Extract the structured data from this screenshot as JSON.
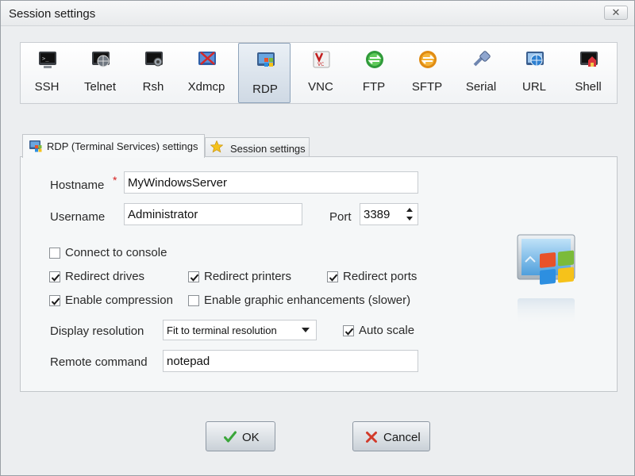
{
  "window": {
    "title": "Session settings",
    "close_symbol": "✕"
  },
  "protocols": [
    {
      "label": "SSH",
      "icon": "ssh-terminal-icon",
      "selected": false
    },
    {
      "label": "Telnet",
      "icon": "telnet-globe-icon",
      "selected": false
    },
    {
      "label": "Rsh",
      "icon": "rsh-terminal-icon",
      "selected": false
    },
    {
      "label": "Xdmcp",
      "icon": "xdmcp-icon",
      "selected": false
    },
    {
      "label": "RDP",
      "icon": "rdp-windows-icon",
      "selected": true
    },
    {
      "label": "VNC",
      "icon": "vnc-icon",
      "selected": false
    },
    {
      "label": "FTP",
      "icon": "ftp-icon",
      "selected": false
    },
    {
      "label": "SFTP",
      "icon": "sftp-icon",
      "selected": false
    },
    {
      "label": "Serial",
      "icon": "serial-plug-icon",
      "selected": false
    },
    {
      "label": "URL",
      "icon": "url-globe-icon",
      "selected": false
    },
    {
      "label": "Shell",
      "icon": "shell-house-icon",
      "selected": false
    }
  ],
  "tabs": [
    {
      "label": "RDP (Terminal Services) settings",
      "icon": "rdp-windows-icon",
      "active": true
    },
    {
      "label": "Session settings",
      "icon": "star-icon",
      "active": false
    }
  ],
  "form": {
    "hostname": {
      "label": "Hostname",
      "required_mark": "*",
      "value": "MyWindowsServer"
    },
    "username": {
      "label": "Username",
      "value": "Administrator"
    },
    "port": {
      "label": "Port",
      "value": "3389"
    },
    "options": {
      "connect_to_console": {
        "label": "Connect to console",
        "checked": false
      },
      "redirect_drives": {
        "label": "Redirect drives",
        "checked": true
      },
      "redirect_printers": {
        "label": "Redirect printers",
        "checked": true
      },
      "redirect_ports": {
        "label": "Redirect ports",
        "checked": true
      },
      "enable_compression": {
        "label": "Enable compression",
        "checked": true
      },
      "enable_graphic_enhancements": {
        "label": "Enable graphic enhancements (slower)",
        "checked": false
      },
      "auto_scale": {
        "label": "Auto scale",
        "checked": true
      }
    },
    "display_resolution": {
      "label": "Display resolution",
      "selected": "Fit to terminal resolution"
    },
    "remote_command": {
      "label": "Remote command",
      "value": "notepad"
    }
  },
  "buttons": {
    "ok": {
      "label": "OK",
      "icon": "checkmark-icon"
    },
    "cancel": {
      "label": "Cancel",
      "icon": "cross-icon"
    }
  },
  "colors": {
    "required": "#d62020",
    "ok_check": "#3aa63a",
    "cancel_cross": "#d23a2a"
  }
}
